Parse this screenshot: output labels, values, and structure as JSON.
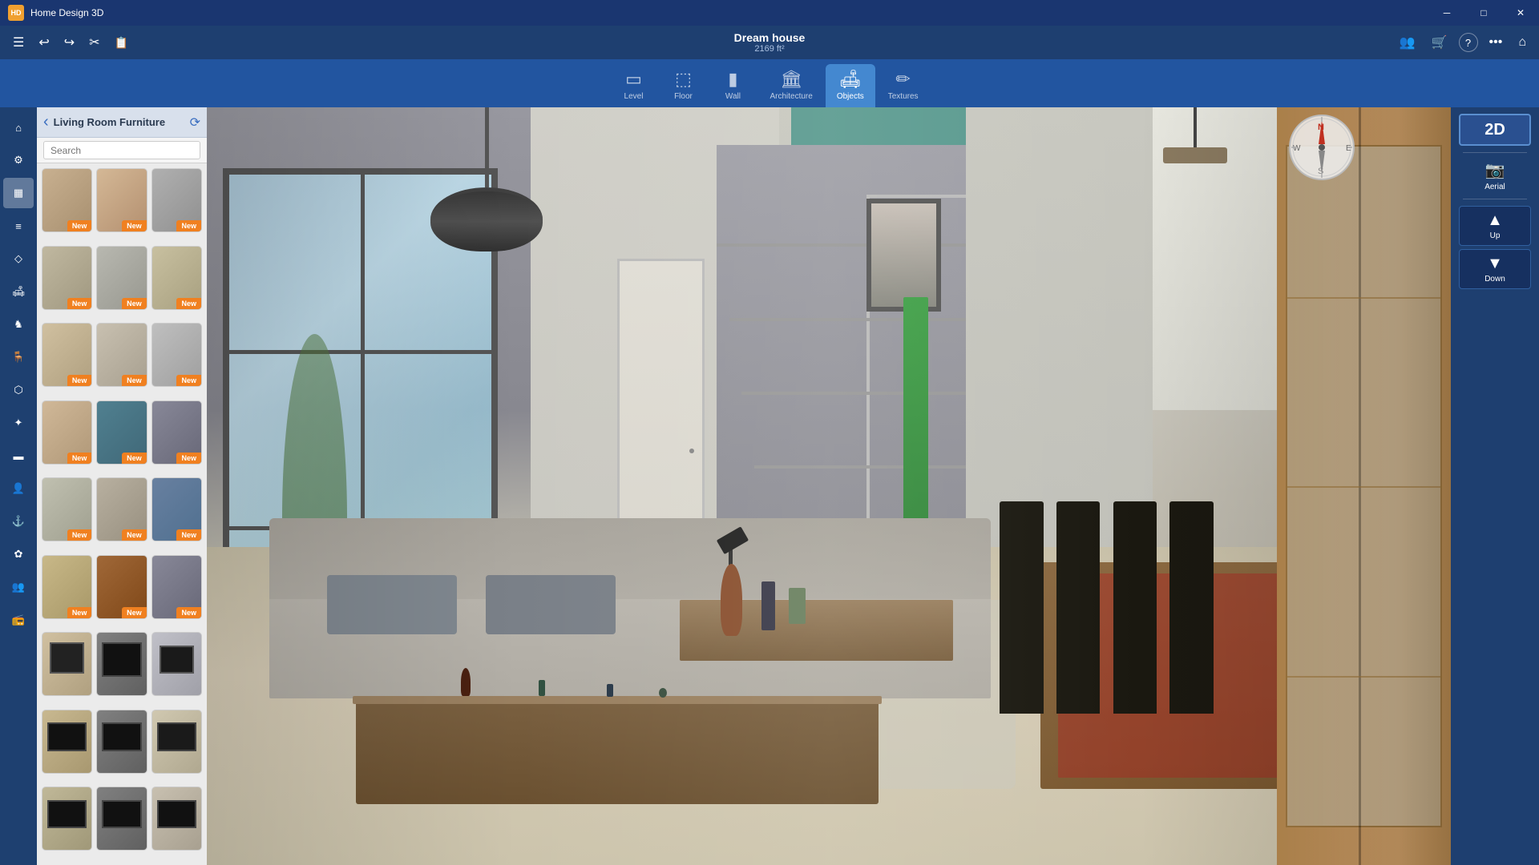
{
  "app": {
    "title": "Home Design 3D",
    "window_controls": {
      "minimize": "─",
      "maximize": "□",
      "close": "✕"
    }
  },
  "project": {
    "name": "Dream house",
    "size": "2169 ft²"
  },
  "toolbar": {
    "menu_icon": "☰",
    "undo": "↩",
    "redo": "↪",
    "scissors": "✂",
    "clipboard": "📋",
    "users": "👥",
    "cart": "🛒",
    "help": "?",
    "more": "⋯",
    "home": "⌂"
  },
  "mode_tabs": [
    {
      "id": "level",
      "label": "Level",
      "icon": "▭"
    },
    {
      "id": "floor",
      "label": "Floor",
      "icon": "⬚"
    },
    {
      "id": "wall",
      "label": "Wall",
      "icon": "▮"
    },
    {
      "id": "architecture",
      "label": "Architecture",
      "icon": "🏠"
    },
    {
      "id": "objects",
      "label": "Objects",
      "icon": "🛋"
    },
    {
      "id": "textures",
      "label": "Textures",
      "icon": "✏"
    }
  ],
  "view_controls": {
    "btn_2d": "2D",
    "aerial": "Aerial",
    "up": "Up",
    "down": "Down"
  },
  "left_icons": [
    {
      "id": "home",
      "icon": "⌂",
      "active": false
    },
    {
      "id": "tools",
      "icon": "⚙",
      "active": false
    },
    {
      "id": "grid",
      "icon": "⊞",
      "active": true
    },
    {
      "id": "layers",
      "icon": "≡",
      "active": false
    },
    {
      "id": "shapes",
      "icon": "◇",
      "active": false
    },
    {
      "id": "couch",
      "icon": "🛋",
      "active": false
    },
    {
      "id": "horse",
      "icon": "♞",
      "active": false
    },
    {
      "id": "chair",
      "icon": "🪑",
      "active": false
    },
    {
      "id": "frame",
      "icon": "⬡",
      "active": false
    },
    {
      "id": "star",
      "icon": "✦",
      "active": false
    },
    {
      "id": "bars",
      "icon": "▬",
      "active": false
    },
    {
      "id": "person",
      "icon": "👤",
      "active": false
    },
    {
      "id": "anchor",
      "icon": "⚓",
      "active": false
    },
    {
      "id": "flower",
      "icon": "✿",
      "active": false
    },
    {
      "id": "group",
      "icon": "👥",
      "active": false
    },
    {
      "id": "radio",
      "icon": "📻",
      "active": false
    }
  ],
  "panel": {
    "title": "Living Room Furniture",
    "search_placeholder": "Search"
  },
  "furniture_items": [
    {
      "id": 1,
      "color": "#c8b090",
      "color2": "#a89070",
      "new": true
    },
    {
      "id": 2,
      "color": "#d4b896",
      "color2": "#b49070",
      "new": true
    },
    {
      "id": 3,
      "color": "#b0b0b0",
      "color2": "#909090",
      "new": true
    },
    {
      "id": 4,
      "color": "#c0b8a0",
      "color2": "#a09880",
      "new": true
    },
    {
      "id": 5,
      "color": "#b8b8b0",
      "color2": "#989890",
      "new": true
    },
    {
      "id": 6,
      "color": "#c8c0a0",
      "color2": "#a8a080",
      "new": true
    },
    {
      "id": 7,
      "color": "#d0c0a0",
      "color2": "#b0a080",
      "new": true
    },
    {
      "id": 8,
      "color": "#c8c0b0",
      "color2": "#a8a090",
      "new": true
    },
    {
      "id": 9,
      "color": "#bfbfbf",
      "color2": "#9f9f9f",
      "new": true
    },
    {
      "id": 10,
      "color": "#d0b898",
      "color2": "#b09878",
      "new": true
    },
    {
      "id": 11,
      "color": "#508090",
      "color2": "#406878",
      "new": true
    },
    {
      "id": 12,
      "color": "#888898",
      "color2": "#686878",
      "new": true
    },
    {
      "id": 13,
      "color": "#c0c0b0",
      "color2": "#a0a090",
      "new": true
    },
    {
      "id": 14,
      "color": "#b8b0a0",
      "color2": "#989080",
      "new": true
    },
    {
      "id": 15,
      "color": "#6880a0",
      "color2": "#507090",
      "new": true
    },
    {
      "id": 16,
      "color": "#c8b888",
      "color2": "#a89868",
      "new": true
    },
    {
      "id": 17,
      "color": "#d0b098",
      "color2": "#b09078",
      "new": true
    },
    {
      "id": 18,
      "color": "#888898",
      "color2": "#686878",
      "new": true
    },
    {
      "id": 19,
      "color": "#d0c0a0",
      "color2": "#b0a080",
      "new": false
    },
    {
      "id": 20,
      "color": "#808080",
      "color2": "#606060",
      "new": false
    },
    {
      "id": 21,
      "color": "#c0c0c8",
      "color2": "#a0a0a8",
      "new": false
    },
    {
      "id": 22,
      "color": "#c8b890",
      "color2": "#a89870",
      "new": false
    },
    {
      "id": 23,
      "color": "#808080",
      "color2": "#606060",
      "new": false
    },
    {
      "id": 24,
      "color": "#d0c8b0",
      "color2": "#b0a890",
      "new": false
    },
    {
      "id": 25,
      "color": "#c0b898",
      "color2": "#a09878",
      "new": false
    },
    {
      "id": 26,
      "color": "#808080",
      "color2": "#606060",
      "new": false
    },
    {
      "id": 27,
      "color": "#c8c0b0",
      "color2": "#a8a090",
      "new": false
    }
  ]
}
